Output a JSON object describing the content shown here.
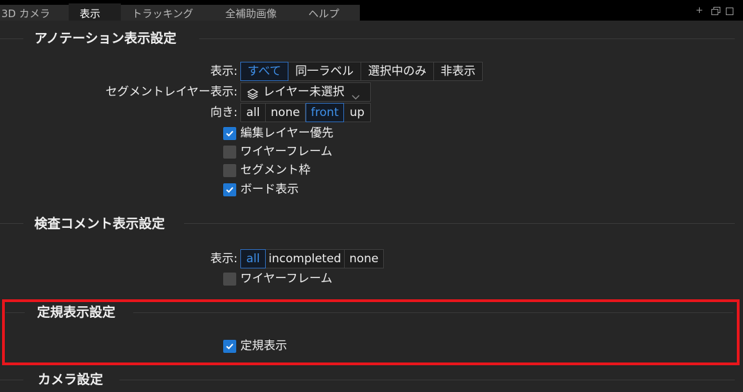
{
  "tabs": [
    {
      "label": "3D カメラ"
    },
    {
      "label": "表示"
    },
    {
      "label": "トラッキング"
    },
    {
      "label": "全補助画像"
    },
    {
      "label": "ヘルプ"
    }
  ],
  "window_controls": {
    "add": "+"
  },
  "annotation": {
    "title": "アノテーション表示設定",
    "display_label": "表示:",
    "display_options": [
      "すべて",
      "同一ラベル",
      "選択中のみ",
      "非表示"
    ],
    "display_selected": "すべて",
    "segment_layer_label": "セグメントレイヤー表示:",
    "segment_layer_value": "レイヤー未選択",
    "orientation_label": "向き:",
    "orientation_options": [
      "all",
      "none",
      "front",
      "up"
    ],
    "orientation_selected": "front",
    "checkboxes": [
      {
        "label": "編集レイヤー優先",
        "checked": true
      },
      {
        "label": "ワイヤーフレーム",
        "checked": false
      },
      {
        "label": "セグメント枠",
        "checked": false
      },
      {
        "label": "ボード表示",
        "checked": true
      }
    ]
  },
  "inspection": {
    "title": "検査コメント表示設定",
    "display_label": "表示:",
    "display_options": [
      "all",
      "incompleted",
      "none"
    ],
    "display_selected": "all",
    "checkboxes": [
      {
        "label": "ワイヤーフレーム",
        "checked": false
      }
    ]
  },
  "ruler": {
    "title": "定規表示設定",
    "checkboxes": [
      {
        "label": "定規表示",
        "checked": true
      }
    ]
  },
  "camera": {
    "title": "カメラ設定"
  },
  "colors": {
    "accent": "#1f78d4",
    "highlight": "#e8161c",
    "background": "#262626"
  }
}
